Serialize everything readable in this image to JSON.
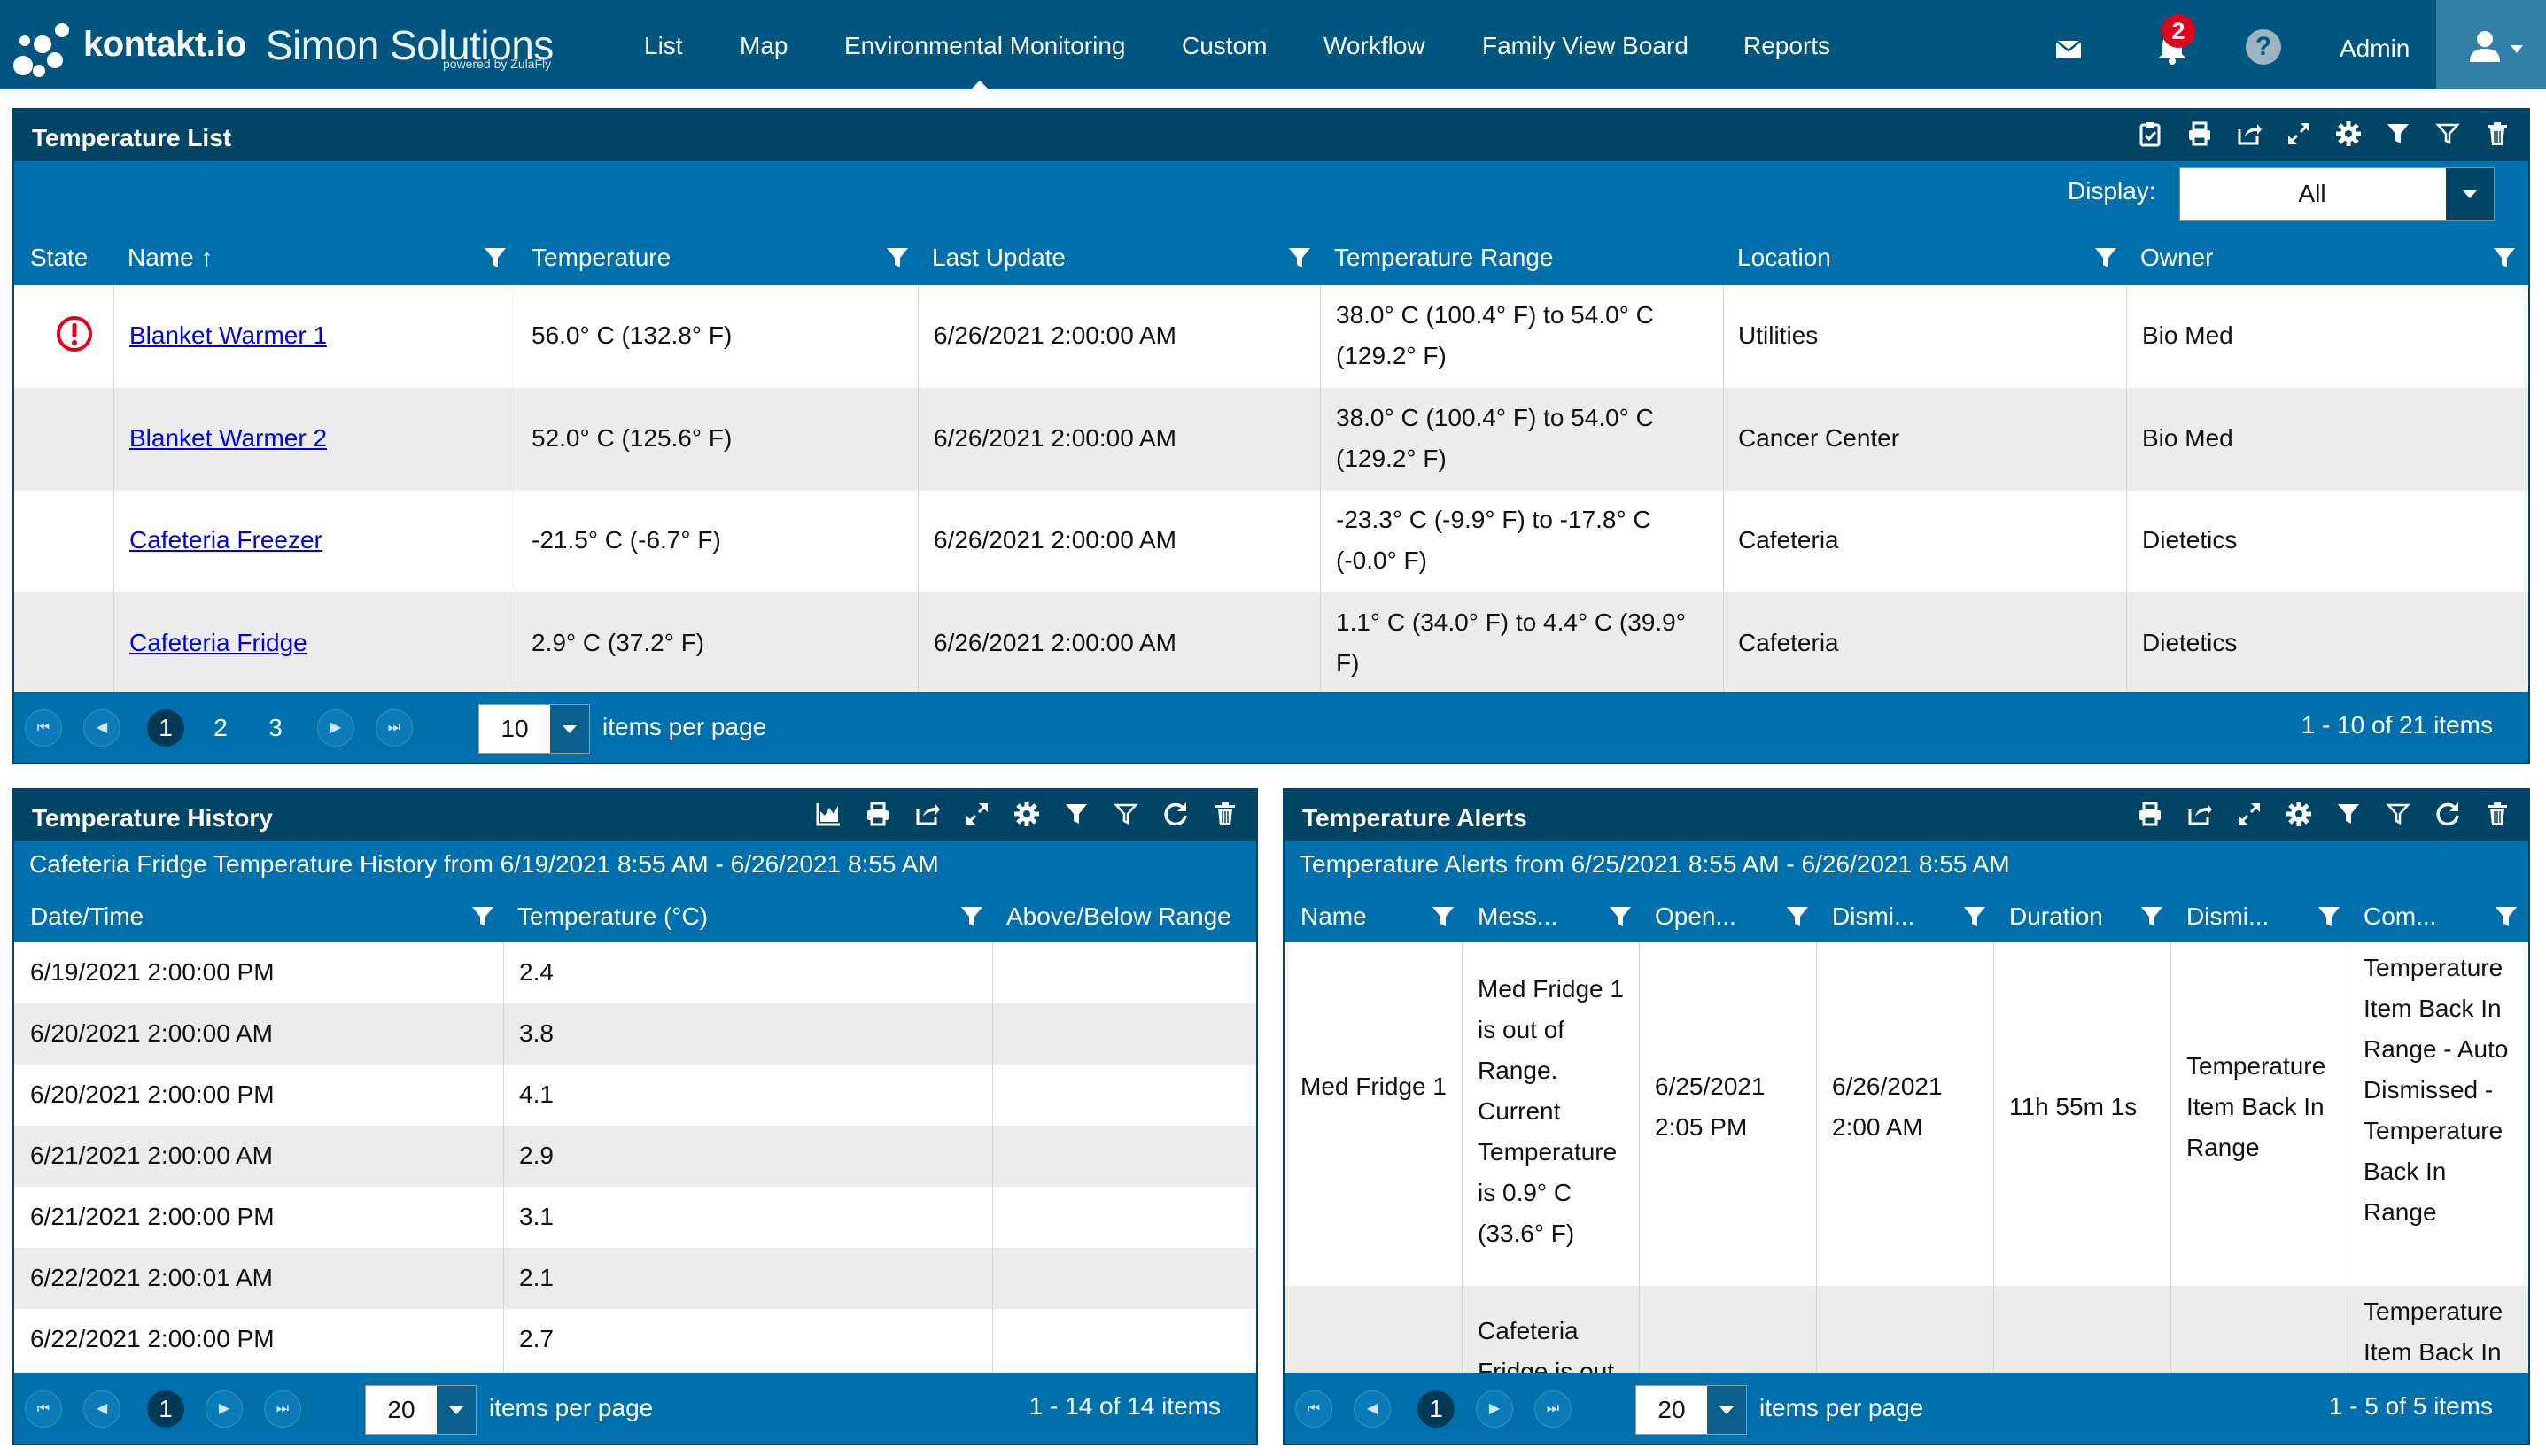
{
  "app": {
    "logo_text": "kontakt.io",
    "brand": "Simon Solutions",
    "brand_sub": "powered by ZulaFly",
    "nav": [
      "List",
      "Map",
      "Environmental Monitoring",
      "Custom",
      "Workflow",
      "Family View Board",
      "Reports"
    ],
    "active_nav": "Environmental Monitoring",
    "notification_count": "2",
    "help_glyph": "?",
    "user_label": "Admin",
    "icons": [
      "logo-icon",
      "mail-icon",
      "bell-icon",
      "help-icon",
      "user-icon"
    ]
  },
  "colors": {
    "navbar": "#00567f",
    "panel_header": "#004566",
    "accent_bar": "#0070ac",
    "alert": "#e2001a",
    "link": "#0000ee"
  },
  "temperature_list": {
    "title": "Temperature List",
    "display_label": "Display:",
    "display_value": "All",
    "columns": [
      "State",
      "Name ↑",
      "Temperature",
      "Last Update",
      "Temperature Range",
      "Location",
      "Owner"
    ],
    "rows": [
      {
        "state": "alert",
        "name": "Blanket Warmer 1",
        "temperature": "56.0° C (132.8° F)",
        "last_update": "6/26/2021 2:00:00 AM",
        "range": "38.0° C (100.4° F) to 54.0° C (129.2° F)",
        "location": "Utilities",
        "owner": "Bio Med"
      },
      {
        "state": "",
        "name": "Blanket Warmer 2",
        "temperature": "52.0° C (125.6° F)",
        "last_update": "6/26/2021 2:00:00 AM",
        "range": "38.0° C (100.4° F) to 54.0° C (129.2° F)",
        "location": "Cancer Center",
        "owner": "Bio Med"
      },
      {
        "state": "",
        "name": "Cafeteria Freezer",
        "temperature": "-21.5° C (-6.7° F)",
        "last_update": "6/26/2021 2:00:00 AM",
        "range": "-23.3° C (-9.9° F) to -17.8° C (-0.0° F)",
        "location": "Cafeteria",
        "owner": "Dietetics"
      },
      {
        "state": "",
        "name": "Cafeteria Fridge",
        "temperature": "2.9° C (37.2° F)",
        "last_update": "6/26/2021 2:00:00 AM",
        "range": "1.1° C (34.0° F) to 4.4° C (39.9° F)",
        "location": "Cafeteria",
        "owner": "Dietetics"
      }
    ],
    "pager": {
      "pages": [
        "1",
        "2",
        "3"
      ],
      "current": "1",
      "page_size": "10",
      "per_page_label": "items per page",
      "info": "1 - 10 of 21 items"
    }
  },
  "temperature_history": {
    "title": "Temperature History",
    "subtitle": "Cafeteria Fridge Temperature History from 6/19/2021 8:55 AM - 6/26/2021 8:55 AM",
    "columns": [
      "Date/Time",
      "Temperature (°C)",
      "Above/Below Range"
    ],
    "rows": [
      {
        "datetime": "6/19/2021 2:00:00 PM",
        "temperature": "2.4",
        "range": ""
      },
      {
        "datetime": "6/20/2021 2:00:00 AM",
        "temperature": "3.8",
        "range": ""
      },
      {
        "datetime": "6/20/2021 2:00:00 PM",
        "temperature": "4.1",
        "range": ""
      },
      {
        "datetime": "6/21/2021 2:00:00 AM",
        "temperature": "2.9",
        "range": ""
      },
      {
        "datetime": "6/21/2021 2:00:00 PM",
        "temperature": "3.1",
        "range": ""
      },
      {
        "datetime": "6/22/2021 2:00:01 AM",
        "temperature": "2.1",
        "range": ""
      },
      {
        "datetime": "6/22/2021 2:00:00 PM",
        "temperature": "2.7",
        "range": ""
      }
    ],
    "pager": {
      "pages": [
        "1"
      ],
      "current": "1",
      "page_size": "20",
      "per_page_label": "items per page",
      "info": "1 - 14 of 14 items"
    }
  },
  "temperature_alerts": {
    "title": "Temperature Alerts",
    "subtitle": "Temperature Alerts from 6/25/2021 8:55 AM - 6/26/2021 8:55 AM",
    "columns": [
      "Name",
      "Mess...",
      "Open...",
      "Dismi...",
      "Duration",
      "Dismi...",
      "Com..."
    ],
    "rows": [
      {
        "name": "Med Fridge 1",
        "message": "Med Fridge 1 is out of Range. Current Temperature is 0.9° C (33.6° F)",
        "opened": "6/25/2021 2:05 PM",
        "dismissed": "6/26/2021 2:00 AM",
        "duration": "11h 55m 1s",
        "dismissed_by": "Temperature Item Back In Range",
        "comment": "Temperature Item Back In Range - Auto Dismissed - Temperature Back In Range"
      },
      {
        "name": "",
        "message": "Cafeteria Fridge is out",
        "opened": "",
        "dismissed": "",
        "duration": "",
        "dismissed_by": "",
        "comment": "Temperature Item Back In"
      }
    ],
    "pager": {
      "pages": [
        "1"
      ],
      "current": "1",
      "page_size": "20",
      "per_page_label": "items per page",
      "info": "1 - 5 of 5 items"
    }
  }
}
